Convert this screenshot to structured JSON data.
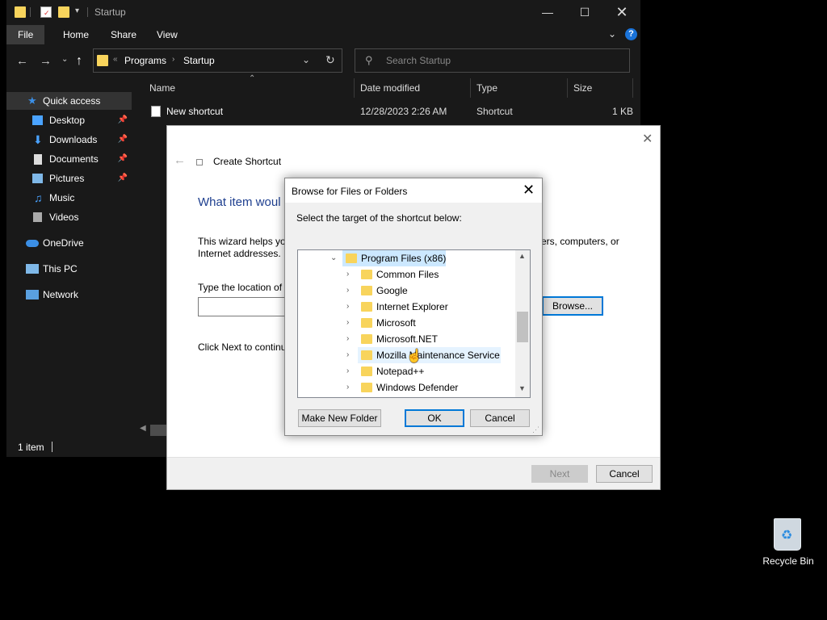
{
  "explorer": {
    "title": "Startup",
    "ribbon_tabs": [
      "File",
      "Home",
      "Share",
      "View"
    ],
    "address": {
      "parts": [
        "Programs",
        "Startup"
      ],
      "prefix": "«"
    },
    "search_placeholder": "Search Startup",
    "sidebar": [
      {
        "label": "Quick access",
        "icon": "star-icon",
        "pinned": false
      },
      {
        "label": "Desktop",
        "icon": "desktop-icon",
        "pinned": true
      },
      {
        "label": "Downloads",
        "icon": "download-icon",
        "pinned": true
      },
      {
        "label": "Documents",
        "icon": "document-icon",
        "pinned": true
      },
      {
        "label": "Pictures",
        "icon": "picture-icon",
        "pinned": true
      },
      {
        "label": "Music",
        "icon": "music-icon",
        "pinned": false
      },
      {
        "label": "Videos",
        "icon": "video-icon",
        "pinned": false
      },
      {
        "label": "OneDrive",
        "icon": "cloud-icon",
        "pinned": false
      },
      {
        "label": "This PC",
        "icon": "pc-icon",
        "pinned": false
      },
      {
        "label": "Network",
        "icon": "network-icon",
        "pinned": false
      }
    ],
    "columns": [
      "Name",
      "Date modified",
      "Type",
      "Size"
    ],
    "files": [
      {
        "name": "New shortcut",
        "date": "12/28/2023 2:26 AM",
        "type": "Shortcut",
        "size": "1 KB"
      }
    ],
    "status": "1 item"
  },
  "wizard": {
    "title": "Create Shortcut",
    "heading": "What item woul",
    "desc_left": "This wizard helps yo",
    "desc_right": "ers, computers, or",
    "desc_line2": "Internet addresses.",
    "loc_label": "Type the location of t",
    "browse_label": "Browse...",
    "continue_text": "Click Next to continu",
    "next_label": "Next",
    "cancel_label": "Cancel"
  },
  "browse_dialog": {
    "title": "Browse for Files or Folders",
    "prompt": "Select the target of the shortcut below:",
    "tree": [
      {
        "name": "Program Files (x86)",
        "expanded": true,
        "level": 0,
        "selected": true
      },
      {
        "name": "Common Files",
        "expanded": false,
        "level": 1
      },
      {
        "name": "Google",
        "expanded": false,
        "level": 1
      },
      {
        "name": "Internet Explorer",
        "expanded": false,
        "level": 1
      },
      {
        "name": "Microsoft",
        "expanded": false,
        "level": 1
      },
      {
        "name": "Microsoft.NET",
        "expanded": false,
        "level": 1
      },
      {
        "name": "Mozilla Maintenance Service",
        "expanded": false,
        "level": 1,
        "hovered": true
      },
      {
        "name": "Notepad++",
        "expanded": false,
        "level": 1
      },
      {
        "name": "Windows Defender",
        "expanded": false,
        "level": 1
      }
    ],
    "new_folder_label": "Make New Folder",
    "ok_label": "OK",
    "cancel_label": "Cancel"
  },
  "desktop": {
    "recycle_bin_label": "Recycle Bin"
  },
  "colors": {
    "accent": "#0078d7",
    "dark_bg": "#191919",
    "folder": "#f8d45c",
    "selected_bg": "#cce8ff",
    "heading_blue": "#1e3f8f"
  }
}
